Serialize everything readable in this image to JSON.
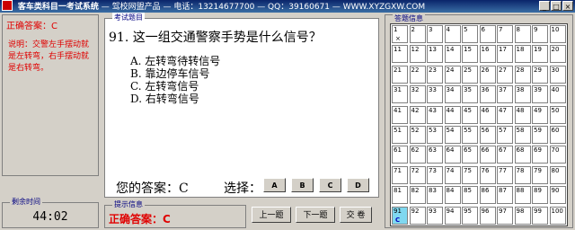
{
  "window": {
    "title": "客车类科目一考试系统",
    "title_rest": "— 驾校网盟产品 — 电话：13214677700 — QQ：39160671 — WWW.XYZGXW.COM",
    "controls": [
      "_",
      "□",
      "×"
    ]
  },
  "left": {
    "correct_answer": "正确答案：C",
    "explanation": "说明：交警左手摆动就是左转弯，右手摆动就是右转弯。"
  },
  "timer": {
    "caption": "剩余时间",
    "value": "44:02"
  },
  "question": {
    "caption": "考试题目",
    "text": "91. 这一组交通警察手势是什么信号？",
    "options": [
      "A. 左转弯待转信号",
      "B. 靠边停车信号",
      "C. 左转弯信号",
      "D. 右转弯信号"
    ],
    "your_answer": "您的答案：C",
    "choose_label": "选择：",
    "choices": [
      "A",
      "B",
      "C",
      "D"
    ]
  },
  "hint": {
    "caption": "提示信息",
    "text": "正确答案：C"
  },
  "nav": {
    "prev": "上一题",
    "next": "下一题",
    "submit": "交 卷"
  },
  "answer_sheet": {
    "caption": "答题信息",
    "current": 91,
    "answered": {
      "1": "×",
      "91": "C"
    }
  }
}
